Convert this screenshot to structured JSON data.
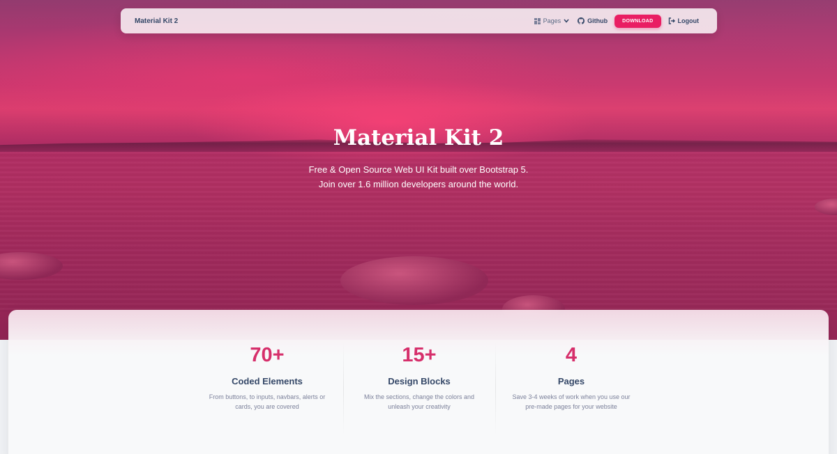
{
  "navbar": {
    "brand": "Material Kit 2",
    "items": {
      "pages": {
        "label": "Pages",
        "icon": "dashboard-grid-icon"
      },
      "github": {
        "label": "Github",
        "icon": "github-icon"
      },
      "download": {
        "label": "DOWNLOAD"
      },
      "logout": {
        "label": "Logout",
        "icon": "logout-icon"
      }
    }
  },
  "hero": {
    "title": "Material Kit 2",
    "subtitle_line1": "Free & Open Source Web UI Kit built over Bootstrap 5.",
    "subtitle_line2": "Join over 1.6 million developers around the world."
  },
  "stats": [
    {
      "value": "70+",
      "title": "Coded Elements",
      "desc_line1": "From buttons, to inputs, navbars, alerts or",
      "desc_line2": "cards, you are covered"
    },
    {
      "value": "15+",
      "title": "Design Blocks",
      "desc_line1": "Mix the sections, change the colors and",
      "desc_line2": "unleash your creativity"
    },
    {
      "value": "4",
      "title": "Pages",
      "desc_line1": "Save 3-4 weeks of work when you use our",
      "desc_line2": "pre-made pages for your website"
    }
  ],
  "colors": {
    "accent": "#e91e63",
    "stat_number": "#d62f6b",
    "heading": "#344767",
    "body_text": "#7b809a"
  }
}
